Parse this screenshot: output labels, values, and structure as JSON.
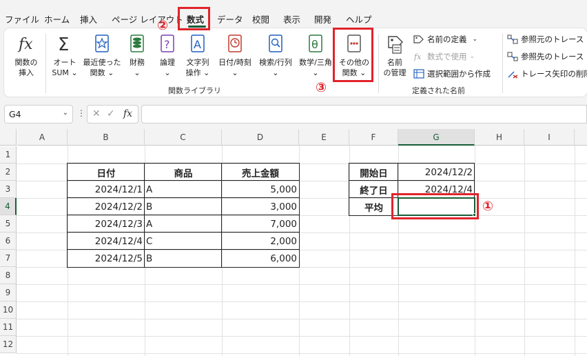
{
  "menu": {
    "tabs": [
      "ファイル",
      "ホーム",
      "挿入",
      "ページ レイアウト",
      "数式",
      "データ",
      "校閲",
      "表示",
      "開発",
      "ヘルプ"
    ],
    "active_tab": "数式"
  },
  "ribbon": {
    "function_library": {
      "insert_function": "関数の\n挿入",
      "autosum": "オート\nSUM ⌄",
      "recent": "最近使った\n関数 ⌄",
      "financial": "財務\n⌄",
      "logical": "論理\n⌄",
      "text": "文字列\n操作 ⌄",
      "datetime": "日付/時刻\n⌄",
      "lookup": "検索/行列\n⌄",
      "math": "数学/三角\n⌄",
      "more": "その他の\n関数 ⌄",
      "group_label": "関数ライブラリ"
    },
    "defined_names": {
      "name_manager": "名前\nの管理",
      "define_name": "名前の定義",
      "use_in_formula": "数式で使用",
      "create_from_selection": "選択範囲から作成",
      "group_label": "定義された名前"
    },
    "formula_auditing": {
      "trace_precedents": "参照元のトレース",
      "trace_dependents": "参照先のトレース",
      "remove_arrows": "トレース矢印の削除"
    }
  },
  "formula_bar": {
    "name_box": "G4",
    "fx": "fx",
    "formula": ""
  },
  "sheet": {
    "columns": [
      "A",
      "B",
      "C",
      "D",
      "E",
      "F",
      "G",
      "H",
      "I"
    ],
    "rows": [
      "1",
      "2",
      "3",
      "4",
      "5",
      "6",
      "7",
      "8",
      "9",
      "10",
      "11",
      "12"
    ],
    "table": {
      "headers": [
        "日付",
        "商品",
        "売上金額"
      ],
      "rows": [
        [
          "2024/12/1",
          "A",
          "5,000"
        ],
        [
          "2024/12/2",
          "B",
          "3,000"
        ],
        [
          "2024/12/3",
          "A",
          "7,000"
        ],
        [
          "2024/12/4",
          "C",
          "2,000"
        ],
        [
          "2024/12/5",
          "B",
          "6,000"
        ]
      ]
    },
    "summary": {
      "start_label": "開始日",
      "start_value": "2024/12/2",
      "end_label": "終了日",
      "end_value": "2024/12/4",
      "avg_label": "平均",
      "avg_value": ""
    }
  },
  "annotations": {
    "step1": "①",
    "step2": "②",
    "step3": "③",
    "highlight_color": "#e0232a"
  },
  "colors": {
    "accent": "#185c37",
    "grid": "#e1e1e1"
  }
}
